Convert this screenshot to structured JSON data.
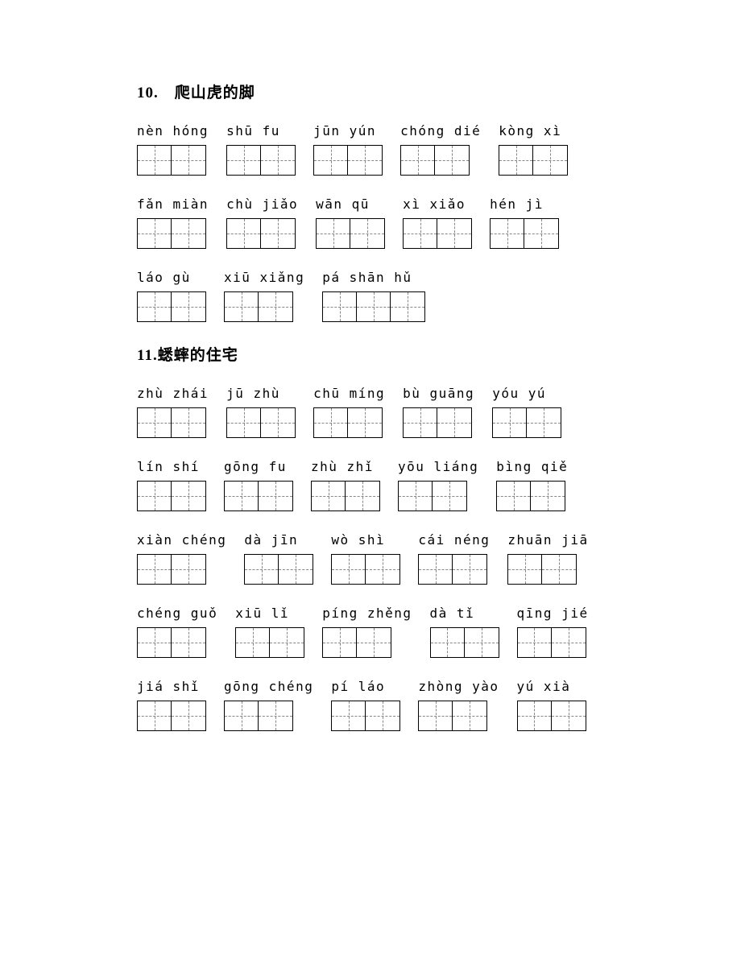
{
  "sections": [
    {
      "title": "10.　爬山虎的脚",
      "rows": [
        [
          {
            "pinyin": "nèn hóng",
            "cells": 2
          },
          {
            "pinyin": "shū fu",
            "cells": 2
          },
          {
            "pinyin": "jūn yún",
            "cells": 2
          },
          {
            "pinyin": "chóng dié",
            "cells": 2
          },
          {
            "pinyin": "kòng xì",
            "cells": 2
          }
        ],
        [
          {
            "pinyin": "fǎn miàn",
            "cells": 2
          },
          {
            "pinyin": "chù jiǎo",
            "cells": 2
          },
          {
            "pinyin": "wān qū",
            "cells": 2
          },
          {
            "pinyin": "xì xiǎo",
            "cells": 2
          },
          {
            "pinyin": "hén jì",
            "cells": 2
          }
        ],
        [
          {
            "pinyin": "láo gù",
            "cells": 2
          },
          {
            "pinyin": "xiū xiǎng",
            "cells": 2
          },
          {
            "pinyin": "pá shān hǔ",
            "cells": 3
          }
        ]
      ]
    },
    {
      "title": "11.蟋蟀的住宅",
      "rows": [
        [
          {
            "pinyin": "zhù zhái",
            "cells": 2
          },
          {
            "pinyin": "jū zhù",
            "cells": 2
          },
          {
            "pinyin": "chū míng",
            "cells": 2
          },
          {
            "pinyin": "bù guāng",
            "cells": 2
          },
          {
            "pinyin": "yóu yú",
            "cells": 2
          }
        ],
        [
          {
            "pinyin": "lín shí",
            "cells": 2
          },
          {
            "pinyin": "gōng fu",
            "cells": 2
          },
          {
            "pinyin": "zhù zhǐ",
            "cells": 2
          },
          {
            "pinyin": "yōu liáng",
            "cells": 2
          },
          {
            "pinyin": "bìng qiě",
            "cells": 2
          }
        ],
        [
          {
            "pinyin": "xiàn chéng",
            "cells": 2
          },
          {
            "pinyin": "dà jīn",
            "cells": 2
          },
          {
            "pinyin": "wò shì",
            "cells": 2
          },
          {
            "pinyin": "cái néng",
            "cells": 2
          },
          {
            "pinyin": "zhuān jiā",
            "cells": 2
          }
        ],
        [
          {
            "pinyin": "chéng guǒ",
            "cells": 2
          },
          {
            "pinyin": "xiū lǐ",
            "cells": 2
          },
          {
            "pinyin": "píng zhěng",
            "cells": 2
          },
          {
            "pinyin": "dà tǐ",
            "cells": 2
          },
          {
            "pinyin": "qīng jié",
            "cells": 2
          }
        ],
        [
          {
            "pinyin": "jiá shǐ",
            "cells": 2
          },
          {
            "pinyin": "gōng chéng",
            "cells": 2
          },
          {
            "pinyin": "pí láo",
            "cells": 2
          },
          {
            "pinyin": "zhòng yào",
            "cells": 2
          },
          {
            "pinyin": "yú xià",
            "cells": 2
          }
        ]
      ]
    }
  ]
}
